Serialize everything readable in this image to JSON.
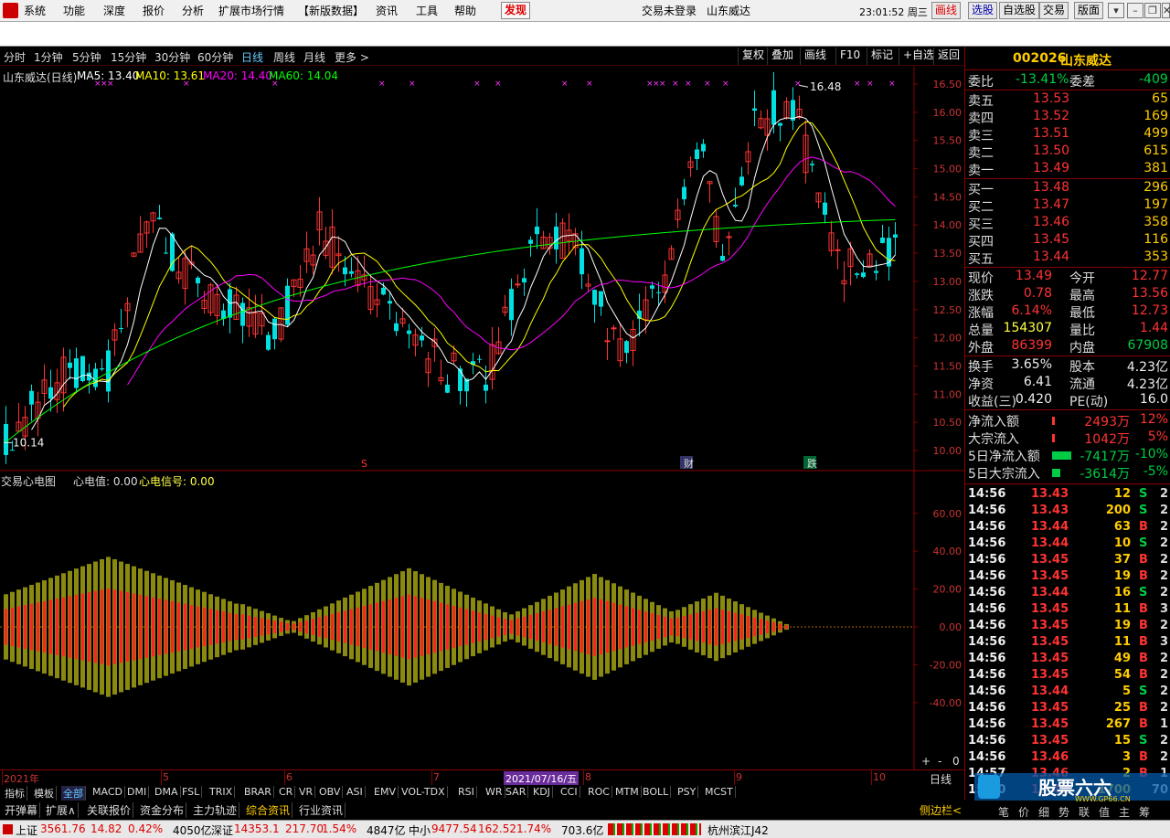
{
  "menu": {
    "items": [
      "系统",
      "功能",
      "深度",
      "报价",
      "分析",
      "扩展市场行情",
      "【新版数据】",
      "资讯",
      "工具",
      "帮助"
    ],
    "discover": "发现",
    "login_status": "交易未登录",
    "stock_name": "山东威达",
    "clock": "23:01:52 周三",
    "right_buttons": [
      "画线",
      "选股",
      "自选股",
      "交易",
      "版面"
    ]
  },
  "toolbar": {
    "periods": [
      "分时",
      "1分钟",
      "5分钟",
      "15分钟",
      "30分钟",
      "60分钟",
      "日线",
      "周线",
      "月线",
      "更多 >"
    ],
    "active_period": "日线",
    "right_buttons": [
      "复权",
      "叠加",
      "画线",
      "F10",
      "标记",
      "+自选",
      "返回"
    ]
  },
  "main_chart": {
    "title": "山东威达(日线)",
    "ma": [
      {
        "label": "MA5: 13.40",
        "color": "#ffffff"
      },
      {
        "label": "MA10: 13.61",
        "color": "#ffff00"
      },
      {
        "label": "MA20: 14.40",
        "color": "#ff00ff"
      },
      {
        "label": "MA60: 14.04",
        "color": "#00ff00"
      }
    ],
    "y_ticks": [
      "16.50",
      "16.00",
      "15.50",
      "15.00",
      "14.50",
      "14.00",
      "13.50",
      "13.00",
      "12.50",
      "12.00",
      "11.50",
      "11.00",
      "10.50",
      "10.00"
    ],
    "high_label": "16.48",
    "low_label": "10.14",
    "markers": [
      "S",
      "财",
      "跌"
    ]
  },
  "indicator": {
    "title": "交易心电图",
    "value_label": "心电值: 0.00",
    "signal_label": "心电信号: 0.00",
    "y_ticks": [
      "60.00",
      "40.00",
      "20.00",
      "0.00",
      "-20.00",
      "-40.00"
    ]
  },
  "x_axis": {
    "labels": [
      "2021年",
      "5",
      "6",
      "7",
      "8",
      "9",
      "10"
    ],
    "cursor_date": "2021/07/16/五",
    "period_label": "日线",
    "zoom": [
      "+",
      "-",
      "0"
    ]
  },
  "chart_data": {
    "type": "candlestick",
    "title": "山东威达(日线)",
    "x_range": [
      "2021-04",
      "2021-10"
    ],
    "ylim": [
      10.0,
      16.5
    ],
    "series": [
      {
        "name": "MA5",
        "values": [
          13.4
        ]
      },
      {
        "name": "MA10",
        "values": [
          13.61
        ]
      },
      {
        "name": "MA20",
        "values": [
          14.4
        ]
      },
      {
        "name": "MA60",
        "values": [
          14.04
        ]
      }
    ],
    "annotations": [
      {
        "label": "16.48",
        "value": 16.48
      },
      {
        "label": "10.14",
        "value": 10.14
      }
    ]
  },
  "quote": {
    "code": "002026",
    "name": "山东威达",
    "weibi_label": "委比",
    "weibi": "-13.41%",
    "weicha_label": "委差",
    "weicha": "-409",
    "asks": [
      {
        "label": "卖五",
        "price": "13.53",
        "vol": "65"
      },
      {
        "label": "卖四",
        "price": "13.52",
        "vol": "169"
      },
      {
        "label": "卖三",
        "price": "13.51",
        "vol": "499"
      },
      {
        "label": "卖二",
        "price": "13.50",
        "vol": "615"
      },
      {
        "label": "卖一",
        "price": "13.49",
        "vol": "381"
      }
    ],
    "bids": [
      {
        "label": "买一",
        "price": "13.48",
        "vol": "296"
      },
      {
        "label": "买二",
        "price": "13.47",
        "vol": "197"
      },
      {
        "label": "买三",
        "price": "13.46",
        "vol": "358"
      },
      {
        "label": "买四",
        "price": "13.45",
        "vol": "116"
      },
      {
        "label": "买五",
        "price": "13.44",
        "vol": "353"
      }
    ],
    "stats": [
      {
        "l1": "现价",
        "v1": "13.49",
        "l2": "今开",
        "v2": "12.77",
        "c1": "red",
        "c2": "red"
      },
      {
        "l1": "涨跌",
        "v1": "0.78",
        "l2": "最高",
        "v2": "13.56",
        "c1": "red",
        "c2": "red"
      },
      {
        "l1": "涨幅",
        "v1": "6.14%",
        "l2": "最低",
        "v2": "12.73",
        "c1": "red",
        "c2": "red"
      },
      {
        "l1": "总量",
        "v1": "154307",
        "l2": "量比",
        "v2": "1.44",
        "c1": "yel",
        "c2": "red"
      },
      {
        "l1": "外盘",
        "v1": "86399",
        "l2": "内盘",
        "v2": "67908",
        "c1": "red",
        "c2": "green"
      },
      {
        "l1": "换手",
        "v1": "3.65%",
        "l2": "股本",
        "v2": "4.23亿",
        "c1": "wht",
        "c2": "wht"
      },
      {
        "l1": "净资",
        "v1": "6.41",
        "l2": "流通",
        "v2": "4.23亿",
        "c1": "wht",
        "c2": "wht"
      },
      {
        "l1": "收益(三)",
        "v1": "0.420",
        "l2": "PE(动)",
        "v2": "16.0",
        "c1": "wht",
        "c2": "wht"
      }
    ],
    "flows": [
      {
        "label": "净流入额",
        "value": "2493万",
        "pct": "12%",
        "color": "red",
        "bar": 0.1
      },
      {
        "label": "大宗流入",
        "value": "1042万",
        "pct": "5%",
        "color": "red",
        "bar": 0.03
      },
      {
        "label": "5日净流入额",
        "value": "-7417万",
        "pct": "-10%",
        "color": "green",
        "bar": 0.7
      },
      {
        "label": "5日大宗流入",
        "value": "-3614万",
        "pct": "-5%",
        "color": "green",
        "bar": 0.3
      }
    ]
  },
  "ticks": [
    {
      "time": "14:56",
      "price": "13.43",
      "vol": "12",
      "bs": "S",
      "n": "2"
    },
    {
      "time": "14:56",
      "price": "13.43",
      "vol": "200",
      "bs": "S",
      "n": "2"
    },
    {
      "time": "14:56",
      "price": "13.44",
      "vol": "63",
      "bs": "B",
      "n": "2"
    },
    {
      "time": "14:56",
      "price": "13.44",
      "vol": "10",
      "bs": "S",
      "n": "2"
    },
    {
      "time": "14:56",
      "price": "13.45",
      "vol": "37",
      "bs": "B",
      "n": "2"
    },
    {
      "time": "14:56",
      "price": "13.45",
      "vol": "19",
      "bs": "B",
      "n": "2"
    },
    {
      "time": "14:56",
      "price": "13.44",
      "vol": "16",
      "bs": "S",
      "n": "2"
    },
    {
      "time": "14:56",
      "price": "13.45",
      "vol": "11",
      "bs": "B",
      "n": "3"
    },
    {
      "time": "14:56",
      "price": "13.45",
      "vol": "19",
      "bs": "B",
      "n": "2"
    },
    {
      "time": "14:56",
      "price": "13.45",
      "vol": "11",
      "bs": "B",
      "n": "3"
    },
    {
      "time": "14:56",
      "price": "13.45",
      "vol": "49",
      "bs": "B",
      "n": "2"
    },
    {
      "time": "14:56",
      "price": "13.45",
      "vol": "54",
      "bs": "B",
      "n": "2"
    },
    {
      "time": "14:56",
      "price": "13.44",
      "vol": "5",
      "bs": "S",
      "n": "2"
    },
    {
      "time": "14:56",
      "price": "13.45",
      "vol": "25",
      "bs": "B",
      "n": "2"
    },
    {
      "time": "14:56",
      "price": "13.45",
      "vol": "267",
      "bs": "B",
      "n": "1"
    },
    {
      "time": "14:56",
      "price": "13.45",
      "vol": "15",
      "bs": "S",
      "n": "2"
    },
    {
      "time": "14:56",
      "price": "13.46",
      "vol": "3",
      "bs": "B",
      "n": "2"
    },
    {
      "time": "14:57",
      "price": "13.46",
      "vol": "2",
      "bs": "B",
      "n": "1"
    },
    {
      "time": "15:00",
      "price": "13.49",
      "vol": "1700",
      "bs": "",
      "n": "70"
    }
  ],
  "indicator_tabs": [
    "指标",
    "模板",
    "全部",
    "MACD",
    "DMI",
    "DMA",
    "FSL",
    "TRIX",
    "BRAR",
    "CR",
    "VR",
    "OBV",
    "ASI",
    "EMV",
    "VOL-TDX",
    "RSI",
    "WR",
    "SAR",
    "KDJ",
    "CCI",
    "ROC",
    "MTM",
    "BOLL",
    "PSY",
    "MCST"
  ],
  "bottom_tabs": [
    "开弹幕",
    "扩展∧",
    "关联报价",
    "资金分布",
    "主力轨迹",
    "综合资讯",
    "行业资讯"
  ],
  "side_toggle": "侧边栏<",
  "right_bottom_tabs": [
    "笔",
    "价",
    "细",
    "势",
    "联",
    "值",
    "主",
    "筹"
  ],
  "watermark": "股票六六",
  "watermark_url": "WWW.GP66.CN",
  "status": {
    "sh_label": "上证",
    "sh_index": "3561.76",
    "sh_chg": "14.82",
    "sh_pct": "0.42%",
    "sh_amt": "4050亿",
    "sz_label": "深证",
    "sz_index": "14353.1",
    "sz_chg": "217.70",
    "sz_pct": "1.54%",
    "sz_amt": "4847亿",
    "zx_label": "中小",
    "zx_index": "9477.54",
    "zx_chg": "162.52",
    "zx_pct": "1.74%",
    "zx_amt": "703.6亿",
    "server": "杭州滨江J42"
  }
}
